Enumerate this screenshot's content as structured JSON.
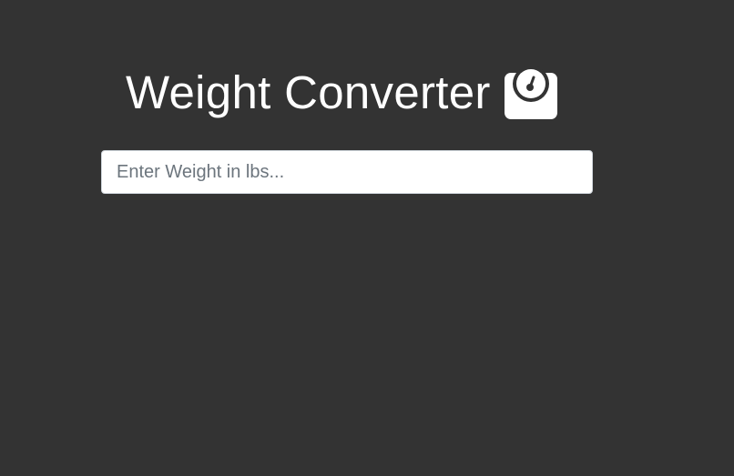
{
  "header": {
    "title": "Weight Converter",
    "icon": "weight-scale-icon"
  },
  "input": {
    "value": "",
    "placeholder": "Enter Weight in lbs..."
  },
  "colors": {
    "background": "#333333",
    "title": "#ffffff",
    "input_background": "#ffffff",
    "input_border": "#ced4da",
    "placeholder": "#6c757d"
  }
}
